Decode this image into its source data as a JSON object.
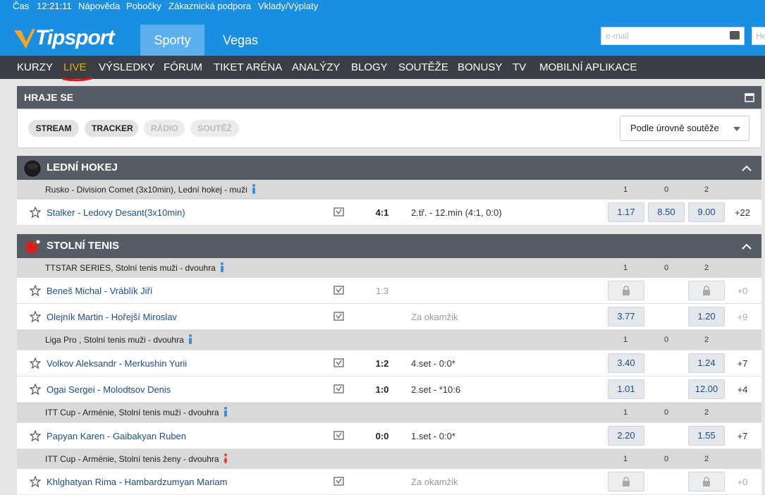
{
  "topbar": {
    "time_label": "Čas",
    "time_value": "12:21:11",
    "links": [
      "Nápověda",
      "Pobočky",
      "Zákaznická podpora",
      "Vklady/Výplaty"
    ]
  },
  "header": {
    "logo_text": "Tipsport",
    "tabs": [
      "Sporty",
      "Vegas"
    ],
    "email_placeholder": "e-mail",
    "password_placeholder": "He"
  },
  "menu": [
    "KURZY",
    "LIVE",
    "VÝSLEDKY",
    "FÓRUM",
    "TIKET ARÉNA",
    "ANALÝZY",
    "BLOGY",
    "SOUTĚŽE",
    "BONUSY",
    "TV",
    "MOBILNÍ APLIKACE"
  ],
  "filter_panel": {
    "title": "HRAJE SE",
    "pills": [
      {
        "label": "STREAM",
        "enabled": true
      },
      {
        "label": "TRACKER",
        "enabled": true
      },
      {
        "label": "RÁDIO",
        "enabled": false
      },
      {
        "label": "SOUTĚŽ",
        "enabled": false
      }
    ],
    "sort_select": "Podle úrovně soutěže"
  },
  "odds_headers": [
    "1",
    "0",
    "2"
  ],
  "sports": [
    {
      "title": "LEDNÍ HOKEJ",
      "icon": "hockey-puck-icon",
      "competitions": [
        {
          "name": "Rusko - Division Comet (3x10min), Lední hokej - muži",
          "gender": "male",
          "matches": [
            {
              "teams": "Stalker - Ledovy Desant(3x10min)",
              "score": "4:1",
              "status": "2.tř. - 12.min (4:1, 0:0)",
              "odds": [
                "1.17",
                "8.50",
                "9.00"
              ],
              "more": "+22"
            }
          ]
        }
      ]
    },
    {
      "title": "STOLNÍ TENIS",
      "icon": "table-tennis-icon",
      "competitions": [
        {
          "name": "TTSTAR SERIES, Stolní tenis muži - dvouhra",
          "gender": "male",
          "matches": [
            {
              "teams": "Beneš Michal - Vráblík Jiří",
              "score": "1:3",
              "status": "",
              "odds": [
                "locked",
                "",
                "locked"
              ],
              "more": "+0"
            },
            {
              "teams": "Olejník Martin - Hořejší Miroslav",
              "score": "",
              "status": "Za okamžik",
              "odds": [
                "3.77",
                "",
                "1.20"
              ],
              "more": "+9"
            }
          ]
        },
        {
          "name": "Liga Pro , Stolní tenis muži - dvouhra",
          "gender": "male",
          "matches": [
            {
              "teams": "Volkov Aleksandr - Merkushin Yurii",
              "score": "1:2",
              "status": "4.set - 0:0*",
              "odds": [
                "3.40",
                "",
                "1.24"
              ],
              "more": "+7"
            },
            {
              "teams": "Ogai Sergei - Molodtsov Denis",
              "score": "1:0",
              "status": "2.set - *10:6",
              "odds": [
                "1.01",
                "",
                "12.00"
              ],
              "more": "+4"
            }
          ]
        },
        {
          "name": "ITT Cup - Arménie, Stolní tenis muži - dvouhra",
          "gender": "male",
          "matches": [
            {
              "teams": "Papyan Karen - Gaibakyan Ruben",
              "score": "0:0",
              "status": "1.set - 0:0*",
              "odds": [
                "2.20",
                "",
                "1.55"
              ],
              "more": "+7"
            }
          ]
        },
        {
          "name": "ITT Cup - Arménie, Stolní tenis ženy - dvouhra",
          "gender": "female",
          "matches": [
            {
              "teams": "Khlghatyan Rima - Hambardzumyan Mariam",
              "score": "",
              "status": "Za okamžik",
              "odds": [
                "locked",
                "",
                "locked"
              ],
              "more": "+0"
            }
          ]
        }
      ]
    }
  ],
  "colors": {
    "brand_blue": "#1a8ee0",
    "menu_dark": "#3b3e44",
    "live_orange": "#f0a01e",
    "panel_head": "#555c66",
    "team_link": "#1d4c8c",
    "male_icon": "#3a8fd6",
    "female_icon": "#e0443c"
  }
}
